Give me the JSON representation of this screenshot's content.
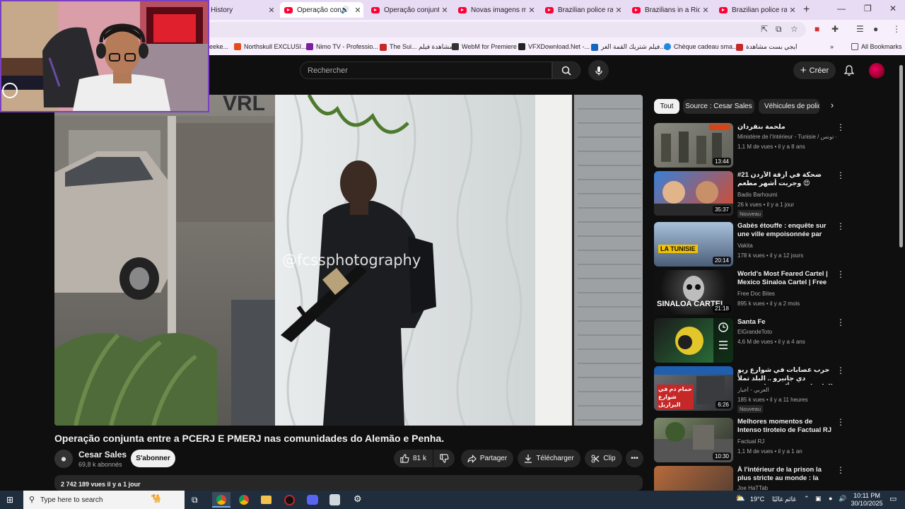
{
  "browser": {
    "tabs": [
      {
        "label": "History",
        "active": false
      },
      {
        "label": "Operação conjunta",
        "active": true
      },
      {
        "label": "Operação conjunta entre",
        "active": false
      },
      {
        "label": "Novas imagens mostram",
        "active": false
      },
      {
        "label": "Brazilian police raid Rio",
        "active": false
      },
      {
        "label": "Brazilians in a Rio favela",
        "active": false
      },
      {
        "label": "Brazilian police raid Rio",
        "active": false
      }
    ],
    "new_tab": "+",
    "window_controls": [
      "—",
      "❐",
      "✕"
    ],
    "bookmarks": [
      {
        "label": "eeke...",
        "color": "#888888"
      },
      {
        "label": "Northskull EXCLUSI...",
        "color": "#e64a19"
      },
      {
        "label": "Nimo TV - Professio...",
        "color": "#7b1fa2"
      },
      {
        "label": "The Sui... مشاهدة فيلم",
        "color": "#c62828"
      },
      {
        "label": "WebM for Premiere",
        "color": "#333333"
      },
      {
        "label": "VFXDownload.Net -...",
        "color": "#222222"
      },
      {
        "label": "فيلم شتريك القمة العر...",
        "color": "#1565c0"
      },
      {
        "label": "Chèque cadeau sma...",
        "color": "#1e88e5"
      },
      {
        "label": "ايجي بست مشاهدة",
        "color": "#c62828"
      }
    ],
    "all_bookmarks": "All Bookmarks"
  },
  "youtube": {
    "search_placeholder": "Rechercher",
    "create_label": "Créer",
    "video": {
      "watermark": "@fcssphotography",
      "title": "Operação conjunta entre a PCERJ E PMERJ nas comunidades do Alemão e Penha.",
      "channel": "Cesar Sales",
      "subscribers": "69,8 k abonnés",
      "subscribe_label": "S'abonner",
      "likes": "81 k",
      "share_label": "Partager",
      "download_label": "Télécharger",
      "clip_label": "Clip",
      "views_date": "2 742 189 vues  il y a 1 jour"
    },
    "chips": [
      "Tout",
      "Source : Cesar Sales",
      "Véhicules de police"
    ],
    "recommendations": [
      {
        "title": "ملحمة بنقردان",
        "channel": "Ministère de l'Intérieur - Tunisie / وزارة الداخلية - تونس",
        "meta": "1,1 M de vues • il y a 8 ans",
        "duration": "13:44",
        "badge": ""
      },
      {
        "title": "#21 ضحكة في أزقة الأردن وجربت أشهر مطعم 😍",
        "channel": "Badis Barhoumi",
        "meta": "26 k vues • il y a 1 jour",
        "duration": "35:37",
        "badge": "Nouveau"
      },
      {
        "title": "Gabès étouffe : enquête sur une ville empoisonnée par un...",
        "channel": "Vakita",
        "meta": "178 k vues • il y a 12 jours",
        "duration": "20:14",
        "badge": "",
        "thumb_text": "LA TUNISIE"
      },
      {
        "title": "World's Most Feared Cartel | Mexico Sinaloa Cartel | Free ...",
        "channel": "Free Doc Bites",
        "meta": "895 k vues • il y a 2 mois",
        "duration": "21:18",
        "badge": "",
        "thumb_text": "SINALOA CARTEL"
      },
      {
        "title": "Santa Fe",
        "channel": "ElGrandeToto",
        "meta": "4,6 M de vues • il y a 4 ans",
        "duration": "",
        "badge": ""
      },
      {
        "title": "حرب عصابات في شوارع ريو دي جانيرو .. البلد تملأ الطرقات بعد أكبر مواجهة بين",
        "channel": "العربي - أخبار",
        "meta": "185 k vues • il y a 11 heures",
        "duration": "6:26",
        "badge": "Nouveau",
        "thumb_text": "حمام دم في شوارع البرازيل"
      },
      {
        "title": "Melhores momentos de Intenso tiroteio de Factual RJ",
        "channel": "Factual RJ",
        "meta": "1,1 M de vues • il y a 1 an",
        "duration": "10:30",
        "badge": ""
      },
      {
        "title": "À l'intérieur de la prison la plus stricte au monde : la guerre ...",
        "channel": "Joe HaTTab",
        "meta": "",
        "duration": "",
        "badge": ""
      }
    ]
  },
  "taskbar": {
    "search_placeholder": "Type here to search",
    "weather": "19°C",
    "weather_label": "غائم غالبًا",
    "time": "10:11 PM",
    "date": "30/10/2025"
  }
}
